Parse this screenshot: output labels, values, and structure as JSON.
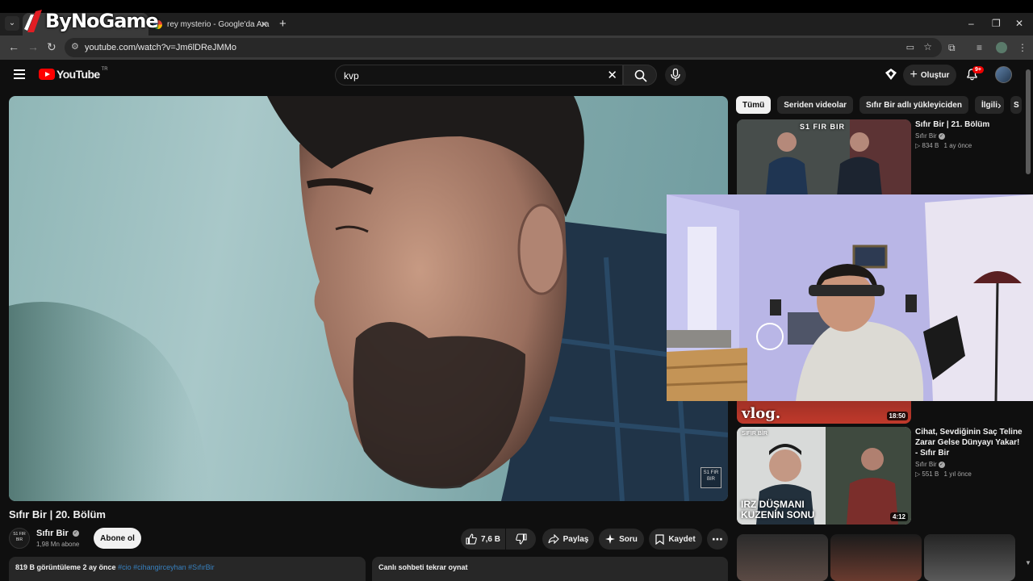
{
  "overlay_logo": "ByNoGame",
  "browser": {
    "tabs": [
      {
        "title": "",
        "active": true
      },
      {
        "title": "rey mysterio - Google'da Ara",
        "active": false
      }
    ],
    "url": "youtube.com/watch?v=Jm6lDReJMMo"
  },
  "youtube": {
    "logo_text": "YouTube",
    "country": "TR",
    "search_query": "kvp",
    "create_label": "Oluştur",
    "notif_badge": "9+"
  },
  "video": {
    "title": "Sıfır Bir | 20. Bölüm",
    "watermark": "S1 FIR BIR",
    "channel": {
      "avatar_text": "S1 FIR BIR",
      "name": "Sıfır Bir",
      "subs": "1,98 Mn abone"
    },
    "subscribe_label": "Abone ol",
    "likes": "7,6 B",
    "share_label": "Paylaş",
    "ask_label": "Soru",
    "save_label": "Kaydet",
    "desc_stats": "819 B görüntüleme  2 ay önce",
    "desc_tags": "#cio #cihangirceyhan #SıfırBir",
    "chat_replay": "Canlı sohbeti tekrar oynat"
  },
  "sidebar": {
    "chips": [
      "Tümü",
      "Seriden videolar",
      "Sıfır Bir adlı yükleyiciden",
      "İlgili",
      "S"
    ],
    "recs": [
      {
        "title": "Sıfır Bir | 21. Bölüm",
        "channel": "Sıfır Bir",
        "views": "834 B",
        "age": "1 ay önce",
        "thumb_text": "S1 FIR BIR"
      },
      {
        "title": "",
        "channel": "",
        "views": "",
        "age": "",
        "thumb_text": "vlog.",
        "duration": "18:50"
      },
      {
        "title": "Cihat, Sevdiğinin Saç Teline Zarar Gelse Dünyayı Yakar! - Sıfır Bir",
        "channel": "Sıfır Bir",
        "views": "551 B",
        "age": "1 yıl önce",
        "thumb_text": "IRZ DÜŞMANI KUZENİN SONU",
        "thumb_tag": "SIFIR BİR",
        "duration": "4:12"
      }
    ]
  },
  "colors": {
    "background": "#0f0f0f",
    "chip_bg": "#272727",
    "accent_red": "#ff0000",
    "link_blue": "#3ea6ff"
  }
}
